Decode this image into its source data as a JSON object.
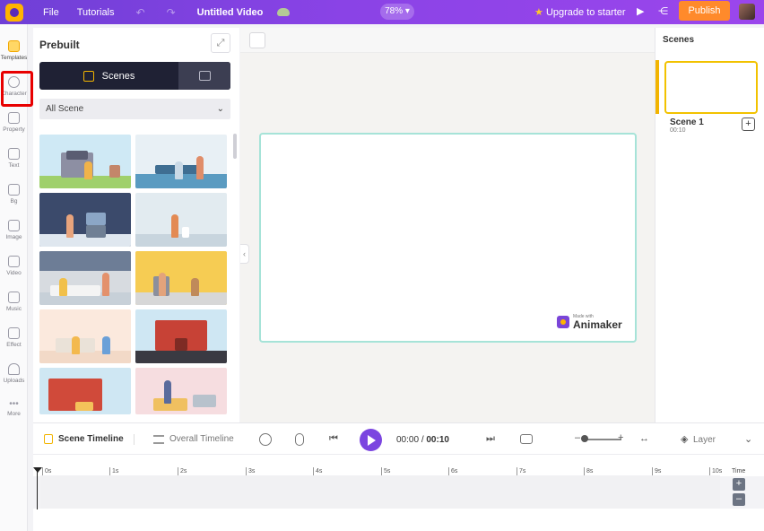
{
  "topbar": {
    "file": "File",
    "tutorials": "Tutorials",
    "undo_icon": "↶",
    "redo_icon": "↷",
    "title": "Untitled Video",
    "zoom": "78%",
    "upgrade": "Upgrade to starter",
    "publish": "Publish"
  },
  "rail": [
    {
      "label": "Templates",
      "icon": "templates-icon"
    },
    {
      "label": "Character",
      "icon": "character-icon"
    },
    {
      "label": "Property",
      "icon": "property-icon"
    },
    {
      "label": "Text",
      "icon": "text-icon"
    },
    {
      "label": "Bg",
      "icon": "bg-icon"
    },
    {
      "label": "Image",
      "icon": "image-icon"
    },
    {
      "label": "Video",
      "icon": "video-icon"
    },
    {
      "label": "Music",
      "icon": "music-icon"
    },
    {
      "label": "Effect",
      "icon": "effect-icon"
    },
    {
      "label": "Uploads",
      "icon": "uploads-icon"
    },
    {
      "label": "More",
      "icon": "more-icon"
    }
  ],
  "panel": {
    "title": "Prebuilt",
    "tab_scenes": "Scenes",
    "filter": "All Scene"
  },
  "stage": {
    "watermark_small": "Made with",
    "watermark_big": "Animaker"
  },
  "scenes": {
    "title": "Scenes",
    "scene_name": "Scene 1",
    "scene_time": "00:10"
  },
  "timeline": {
    "scene_timeline": "Scene Timeline",
    "overall_timeline": "Overall Timeline",
    "current_time": "00:00",
    "separator": "/",
    "total_time": "00:10",
    "layer": "Layer",
    "time_label": "Time",
    "ticks": [
      "0s",
      "1s",
      "2s",
      "3s",
      "4s",
      "5s",
      "6s",
      "7s",
      "8s",
      "9s",
      "10s"
    ]
  },
  "colors": {
    "accent": "#7b45e0",
    "publish": "#ff8a2b",
    "highlight": "#e80000",
    "scene_select": "#f2c200",
    "stage_border": "#a6e3d8"
  }
}
